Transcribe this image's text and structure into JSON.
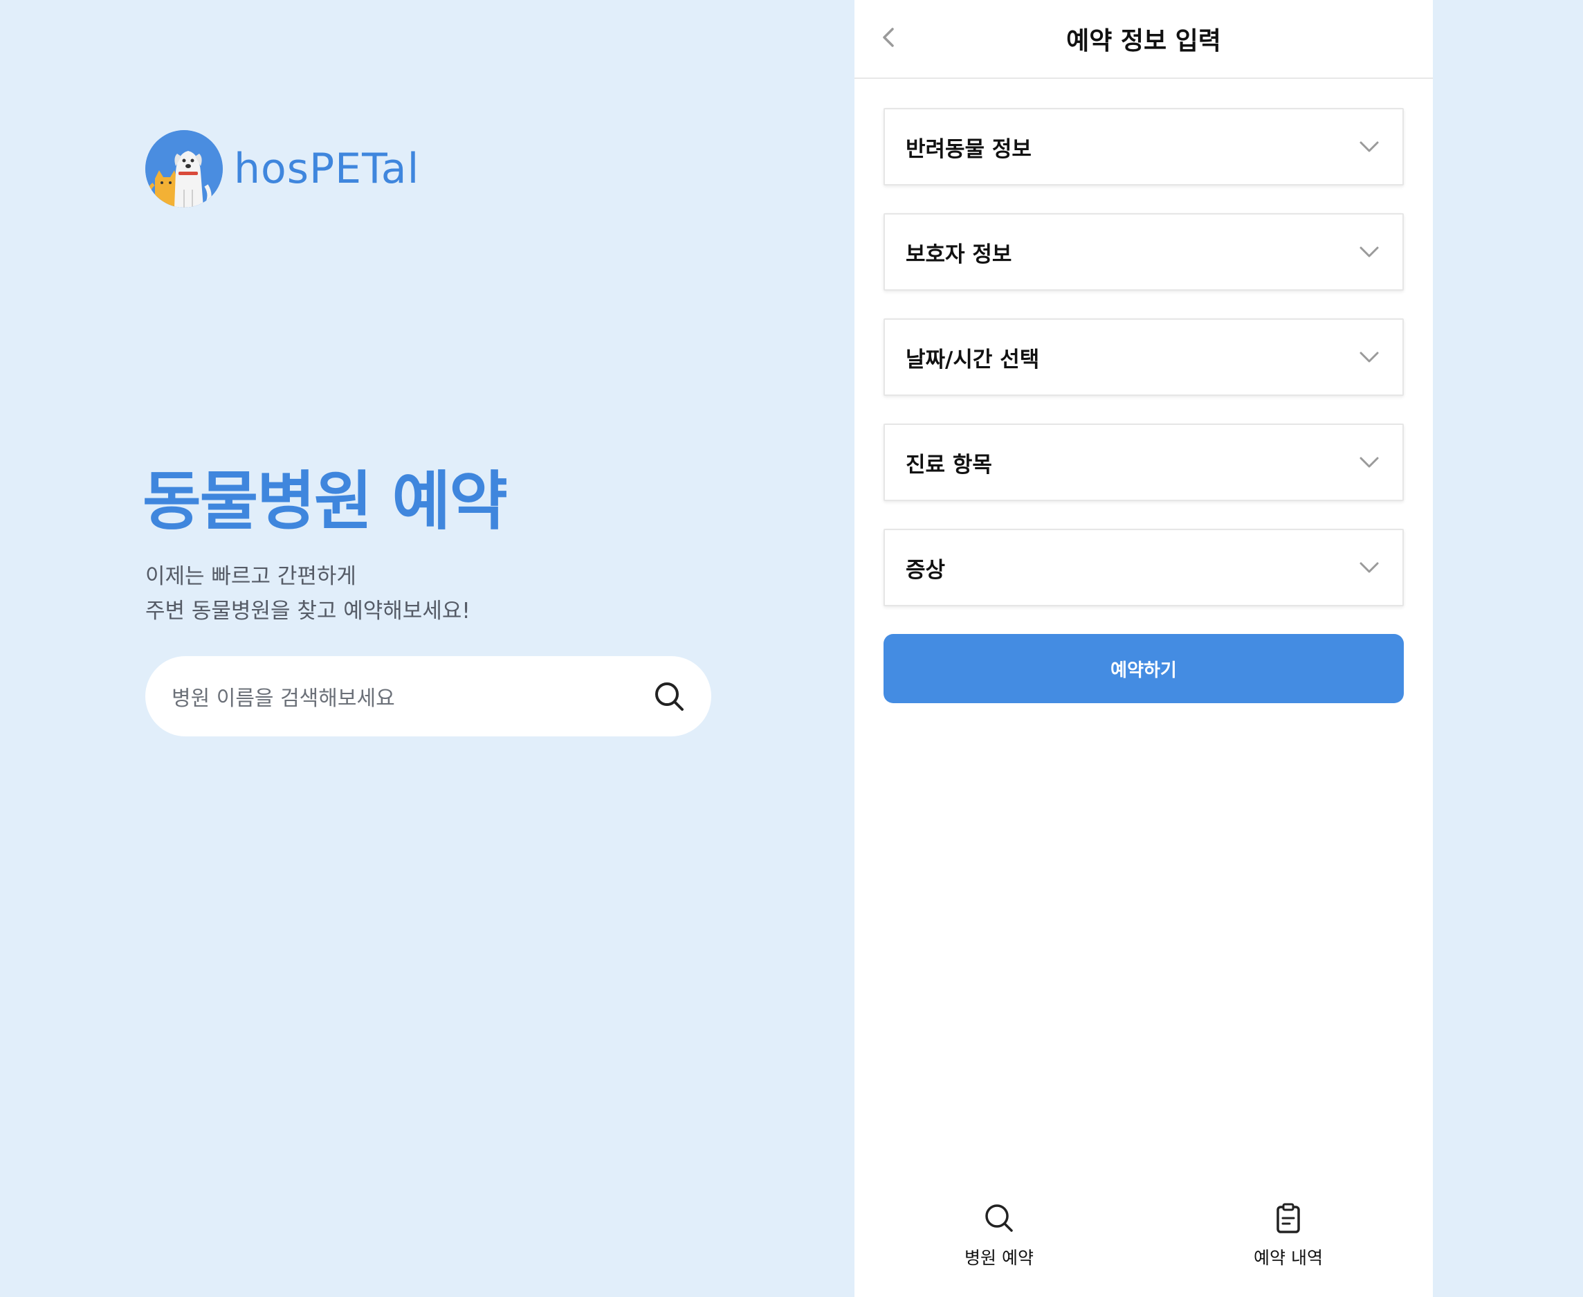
{
  "brand": {
    "logo_text": "hosPETal",
    "accent_color": "#3f86dd"
  },
  "hero": {
    "title": "동물병원 예약",
    "subtitle_line1": "이제는 빠르고 간편하게",
    "subtitle_line2": "주변 동물병원을 찾고 예약해보세요!"
  },
  "search": {
    "placeholder": "병원 이름을 검색해보세요",
    "icon": "search-icon"
  },
  "panel": {
    "title": "예약 정보 입력",
    "back_icon": "chevron-left-icon",
    "sections": [
      {
        "label": "반려동물 정보",
        "icon": "chevron-down-icon"
      },
      {
        "label": "보호자 정보",
        "icon": "chevron-down-icon"
      },
      {
        "label": "날짜/시간 선택",
        "icon": "chevron-down-icon"
      },
      {
        "label": "진료 항목",
        "icon": "chevron-down-icon"
      },
      {
        "label": "증상",
        "icon": "chevron-down-icon"
      }
    ],
    "submit_label": "예약하기",
    "submit_color": "#448ce2"
  },
  "tabbar": {
    "tabs": [
      {
        "label": "병원 예약",
        "icon": "search-icon"
      },
      {
        "label": "예약 내역",
        "icon": "clipboard-icon"
      }
    ]
  }
}
